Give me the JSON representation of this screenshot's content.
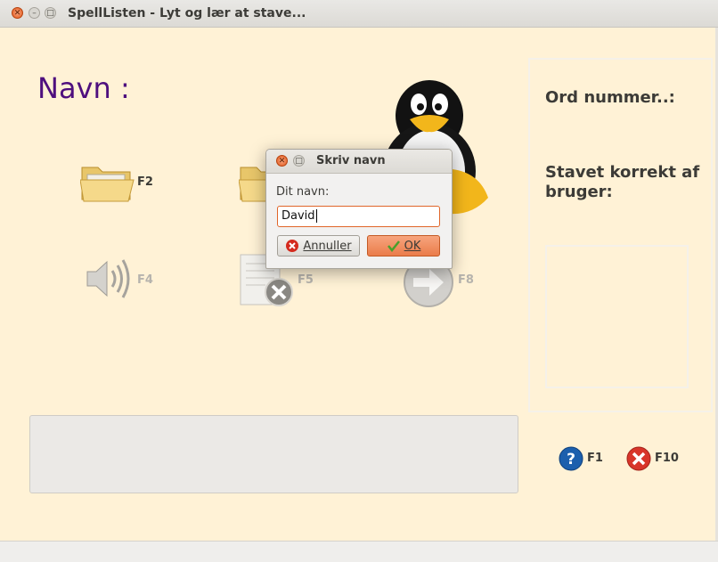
{
  "window": {
    "title": "SpellListen - Lyt og lær at stave..."
  },
  "main": {
    "name_label": "Navn :",
    "shortcuts": {
      "open": "F2",
      "listen": "F4",
      "clear": "F5",
      "next": "F8",
      "help": "F1",
      "quit": "F10"
    }
  },
  "side_panel": {
    "word_number_label": "Ord nummer..:",
    "spelled_correct_label": "Stavet korrekt af bruger:"
  },
  "dialog": {
    "title": "Skriv navn",
    "prompt_label": "Dit navn:",
    "name_value": "David",
    "cancel_label": "Annuller",
    "ok_label": "OK"
  },
  "colors": {
    "background": "#fff2d6",
    "name_label": "#4e0f7e",
    "accent": "#e2571b"
  }
}
